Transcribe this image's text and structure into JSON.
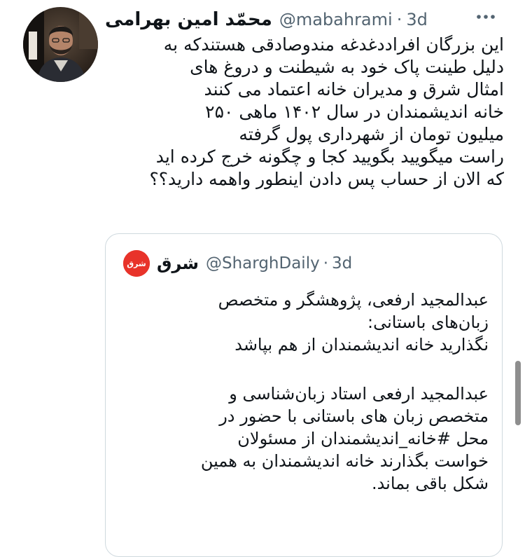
{
  "tweet": {
    "author_name": "محمّد امین بهرامی",
    "handle": "@mabahrami",
    "separator": "·",
    "time": "3d",
    "body_lines": [
      "این بزرگان افراددغدغه مندوصادقی هستندکه به",
      "دلیل طینت پاک خود به شیطنت و دروغ های",
      "امثال شرق و مدیران خانه اعتماد می کنند",
      "خانه اندیشمندان در سال ۱۴۰۲ ماهی ۲۵۰",
      "میلیون تومان از شهرداری پول گرفته",
      "راست میگویید بگویید کجا و چگونه خرج کرده اید",
      "که الان از حساب پس دادن اینطور واهمه دارید؟؟"
    ]
  },
  "quote": {
    "author_name": "شرق",
    "handle": "@SharghDaily",
    "separator": "·",
    "time": "3d",
    "avatar_text": "شرق",
    "body_lines_1": [
      "عبدالمجید ارفعی، پژوهشگر و متخصص",
      "زبان‌های باستانی:",
      "نگذارید خانه اندیشمندان از هم بپاشد"
    ],
    "body_lines_2": [
      "عبدالمجید ارفعی استاد زبان‌شناسی و",
      "متخصص زبان های باستانی با حضور در",
      "محل #خانه_اندیشمندان از مسئولان",
      "خواست بگذارند خانه اندیشمندان به همین",
      "شکل باقی بماند."
    ]
  },
  "icons": {
    "more": "more-horizontal-icon",
    "avatar": "profile-photo",
    "quote_avatar": "shargh-logo"
  },
  "colors": {
    "text": "#0f1419",
    "secondary": "#536471",
    "border": "#cfd9de",
    "shargh_red": "#e8332a"
  }
}
